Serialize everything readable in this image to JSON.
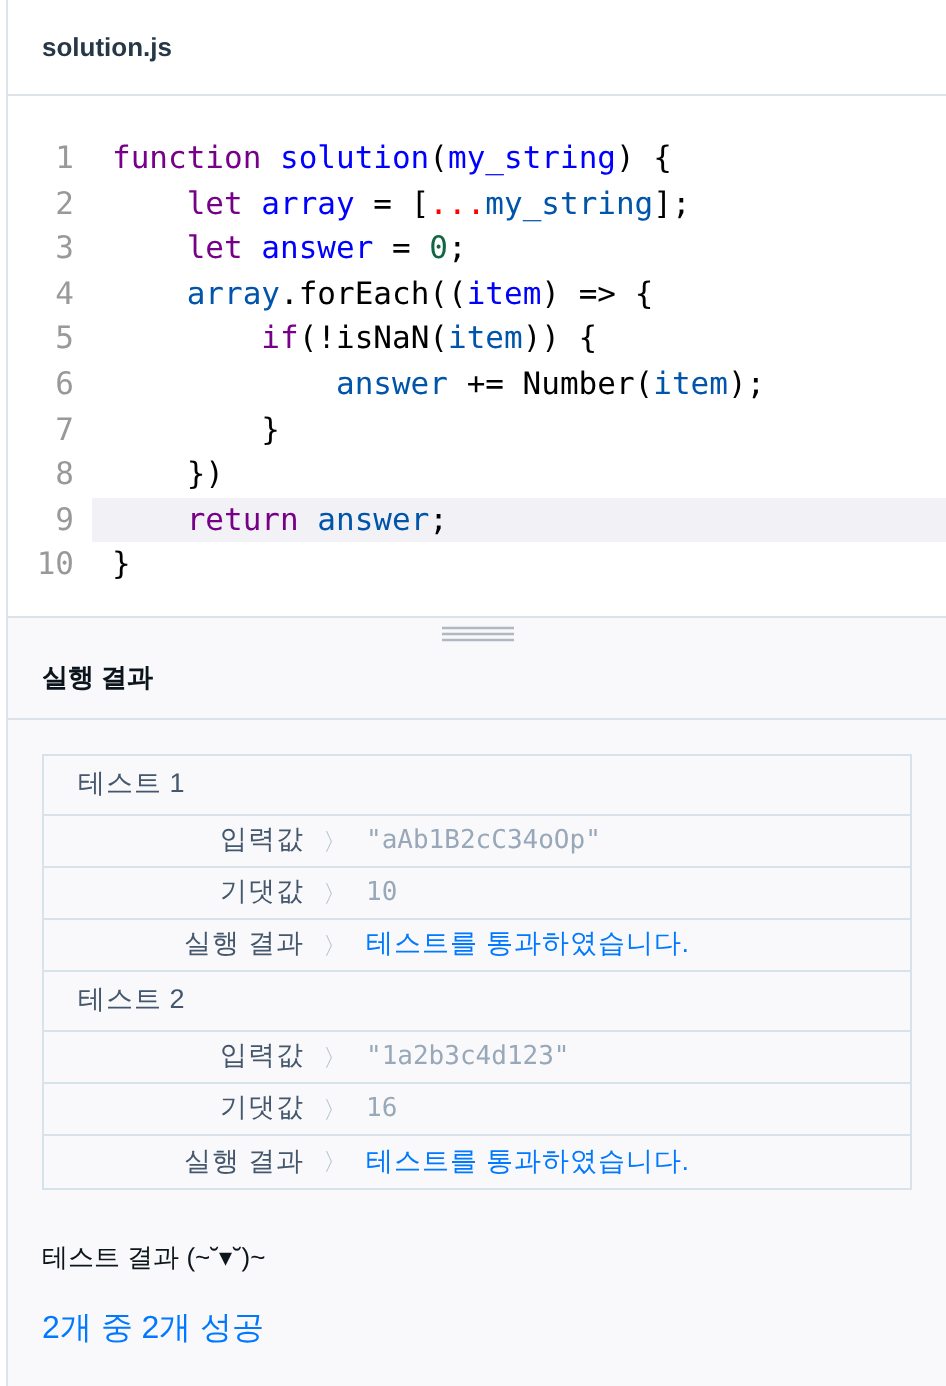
{
  "file_tab": {
    "title": "solution.js"
  },
  "code": {
    "lines": [
      {
        "number": "1",
        "current": false,
        "tokens": [
          {
            "text": "function",
            "kind": "keyword"
          },
          {
            "text": " solution",
            "kind": "def"
          },
          {
            "text": "(",
            "kind": "plain"
          },
          {
            "text": "my_string",
            "kind": "def"
          },
          {
            "text": ") {",
            "kind": "plain"
          }
        ]
      },
      {
        "number": "2",
        "current": false,
        "tokens": [
          {
            "text": "    let",
            "kind": "keyword"
          },
          {
            "text": " array",
            "kind": "def"
          },
          {
            "text": " = [",
            "kind": "plain"
          },
          {
            "text": "...",
            "kind": "spread"
          },
          {
            "text": "my_string",
            "kind": "var"
          },
          {
            "text": "];",
            "kind": "plain"
          }
        ]
      },
      {
        "number": "3",
        "current": false,
        "tokens": [
          {
            "text": "    let",
            "kind": "keyword"
          },
          {
            "text": " answer",
            "kind": "def"
          },
          {
            "text": " = ",
            "kind": "plain"
          },
          {
            "text": "0",
            "kind": "number"
          },
          {
            "text": ";",
            "kind": "plain"
          }
        ]
      },
      {
        "number": "4",
        "current": false,
        "tokens": [
          {
            "text": "    array",
            "kind": "var"
          },
          {
            "text": ".forEach((",
            "kind": "plain"
          },
          {
            "text": "item",
            "kind": "def"
          },
          {
            "text": ") => {",
            "kind": "plain"
          }
        ]
      },
      {
        "number": "5",
        "current": false,
        "tokens": [
          {
            "text": "        if",
            "kind": "keyword"
          },
          {
            "text": "(!isNaN(",
            "kind": "plain"
          },
          {
            "text": "item",
            "kind": "var"
          },
          {
            "text": ")) {",
            "kind": "plain"
          }
        ]
      },
      {
        "number": "6",
        "current": false,
        "tokens": [
          {
            "text": "            answer",
            "kind": "var"
          },
          {
            "text": " += Number(",
            "kind": "plain"
          },
          {
            "text": "item",
            "kind": "var"
          },
          {
            "text": ");",
            "kind": "plain"
          }
        ]
      },
      {
        "number": "7",
        "current": false,
        "tokens": [
          {
            "text": "        }",
            "kind": "plain"
          }
        ]
      },
      {
        "number": "8",
        "current": false,
        "tokens": [
          {
            "text": "    })",
            "kind": "plain"
          }
        ]
      },
      {
        "number": "9",
        "current": true,
        "tokens": [
          {
            "text": "    return",
            "kind": "keyword"
          },
          {
            "text": " answer",
            "kind": "var"
          },
          {
            "text": ";",
            "kind": "plain"
          }
        ]
      },
      {
        "number": "10",
        "current": false,
        "tokens": [
          {
            "text": "}",
            "kind": "plain"
          }
        ]
      }
    ]
  },
  "results": {
    "title": "실행 결과",
    "tests": [
      {
        "title": "테스트 1",
        "rows": [
          {
            "label": "입력값",
            "separator": "〉",
            "value": "\"aAb1B2cC34oOp\"",
            "kind": "value"
          },
          {
            "label": "기댓값",
            "separator": "〉",
            "value": "10",
            "kind": "value"
          },
          {
            "label": "실행 결과",
            "separator": "〉",
            "value": "테스트를 통과하였습니다.",
            "kind": "pass"
          }
        ]
      },
      {
        "title": "테스트 2",
        "rows": [
          {
            "label": "입력값",
            "separator": "〉",
            "value": "\"1a2b3c4d123\"",
            "kind": "value"
          },
          {
            "label": "기댓값",
            "separator": "〉",
            "value": "16",
            "kind": "value"
          },
          {
            "label": "실행 결과",
            "separator": "〉",
            "value": "테스트를 통과하였습니다.",
            "kind": "pass"
          }
        ]
      }
    ],
    "summary_title": "테스트 결과 (~˘▾˘)~",
    "summary": "2개 중 2개 성공"
  }
}
